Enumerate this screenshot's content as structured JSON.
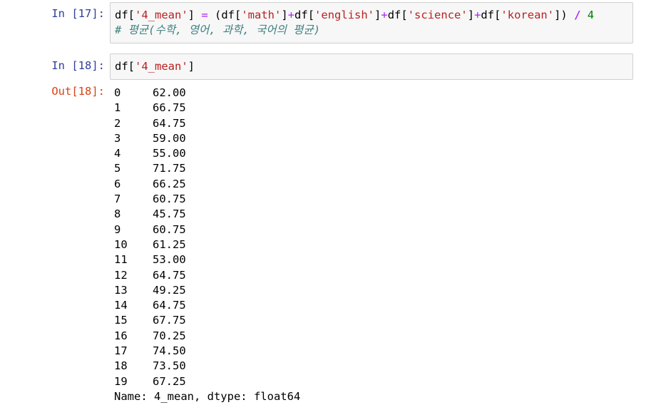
{
  "cells": [
    {
      "prompt": "In [17]:",
      "code_lines": [
        [
          {
            "t": "df[",
            "c": ""
          },
          {
            "t": "'4_mean'",
            "c": "tok-str"
          },
          {
            "t": "] ",
            "c": ""
          },
          {
            "t": "=",
            "c": "tok-op"
          },
          {
            "t": " (df[",
            "c": ""
          },
          {
            "t": "'math'",
            "c": "tok-str"
          },
          {
            "t": "]",
            "c": ""
          },
          {
            "t": "+",
            "c": "tok-op"
          },
          {
            "t": "df[",
            "c": ""
          },
          {
            "t": "'english'",
            "c": "tok-str"
          },
          {
            "t": "]",
            "c": ""
          },
          {
            "t": "+",
            "c": "tok-op"
          },
          {
            "t": "df[",
            "c": ""
          },
          {
            "t": "'science'",
            "c": "tok-str"
          },
          {
            "t": "]",
            "c": ""
          },
          {
            "t": "+",
            "c": "tok-op"
          },
          {
            "t": "df[",
            "c": ""
          },
          {
            "t": "'korean'",
            "c": "tok-str"
          },
          {
            "t": "]) ",
            "c": ""
          },
          {
            "t": "/",
            "c": "tok-opw"
          },
          {
            "t": " ",
            "c": ""
          },
          {
            "t": "4",
            "c": "tok-num"
          }
        ],
        [
          {
            "t": "# 평균(수학, 영어, 과학, 국어의 평균)",
            "c": "tok-comment"
          }
        ]
      ]
    },
    {
      "prompt": "In [18]:",
      "code_lines": [
        [
          {
            "t": "df[",
            "c": ""
          },
          {
            "t": "'4_mean'",
            "c": "tok-str"
          },
          {
            "t": "]",
            "c": ""
          }
        ]
      ]
    }
  ],
  "output": {
    "prompt": "Out[18]:",
    "rows": [
      {
        "index": "0",
        "value": "62.00"
      },
      {
        "index": "1",
        "value": "66.75"
      },
      {
        "index": "2",
        "value": "64.75"
      },
      {
        "index": "3",
        "value": "59.00"
      },
      {
        "index": "4",
        "value": "55.00"
      },
      {
        "index": "5",
        "value": "71.75"
      },
      {
        "index": "6",
        "value": "66.25"
      },
      {
        "index": "7",
        "value": "60.75"
      },
      {
        "index": "8",
        "value": "45.75"
      },
      {
        "index": "9",
        "value": "60.75"
      },
      {
        "index": "10",
        "value": "61.25"
      },
      {
        "index": "11",
        "value": "53.00"
      },
      {
        "index": "12",
        "value": "64.75"
      },
      {
        "index": "13",
        "value": "49.25"
      },
      {
        "index": "14",
        "value": "64.75"
      },
      {
        "index": "15",
        "value": "67.75"
      },
      {
        "index": "16",
        "value": "70.25"
      },
      {
        "index": "17",
        "value": "74.50"
      },
      {
        "index": "18",
        "value": "73.50"
      },
      {
        "index": "19",
        "value": "67.25"
      }
    ],
    "footer": "Name: 4_mean, dtype: float64"
  }
}
